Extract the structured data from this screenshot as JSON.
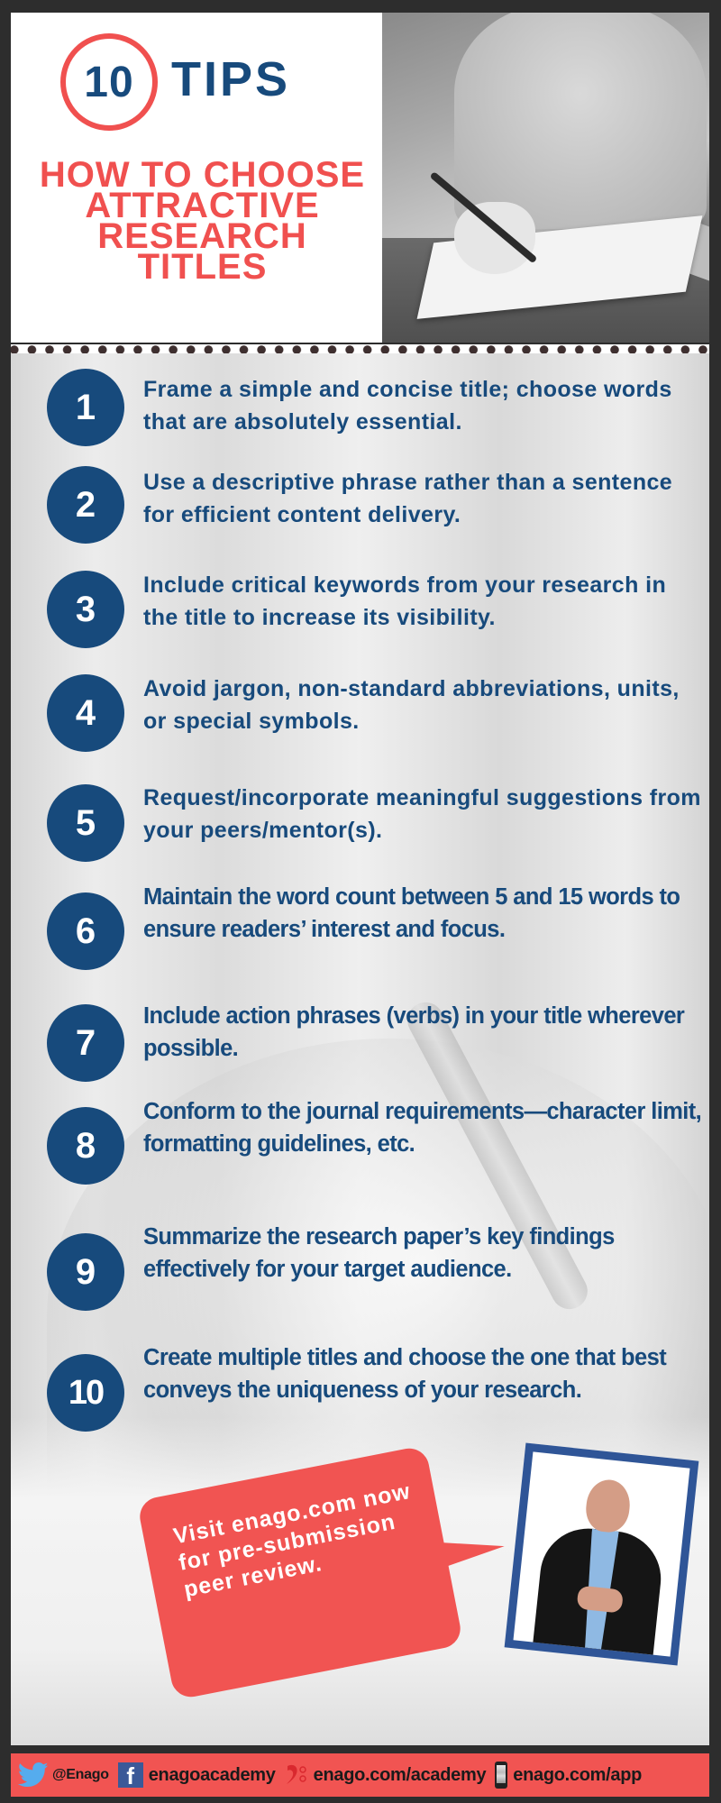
{
  "header": {
    "number": "10",
    "tips_word": "TIPS",
    "subtitle_lines": [
      "HOW TO CHOOSE",
      "ATTRACTIVE",
      "RESEARCH TITLES"
    ]
  },
  "tips": [
    {
      "number": "1",
      "text": "Frame a simple and concise title; choose words that are absolutely essential."
    },
    {
      "number": "2",
      "text": "Use a descriptive phrase rather than a sentence for efficient content delivery."
    },
    {
      "number": "3",
      "text": "Include critical keywords from your research in the title to increase its visibility."
    },
    {
      "number": "4",
      "text": "Avoid jargon, non-standard abbreviations, units, or special symbols."
    },
    {
      "number": "5",
      "text": "Request/incorporate meaningful suggestions from your peers/mentor(s)."
    },
    {
      "number": "6",
      "text": "Maintain the word count between 5 and 15 words to ensure readers’ interest and focus."
    },
    {
      "number": "7",
      "text": "Include action phrases (verbs) in your title wherever possible."
    },
    {
      "number": "8",
      "text": "Conform to the journal requirements—character limit, formatting guidelines, etc."
    },
    {
      "number": "9",
      "text": "Summarize the research paper’s key findings effectively for your target audience."
    },
    {
      "number": "10",
      "text": "Create multiple titles and choose the one that best conveys the uniqueness of your research."
    }
  ],
  "callout": {
    "text": "Visit enago.com now for pre-submission peer review."
  },
  "footer": {
    "twitter": {
      "icon": "twitter-icon",
      "label": "@Enago"
    },
    "facebook": {
      "icon": "facebook-icon",
      "glyph": "f",
      "label": "enagoacademy"
    },
    "academy": {
      "icon": "enago-academy-icon",
      "label": "enago.com/academy"
    },
    "app": {
      "icon": "phone-icon",
      "label": "enago.com/app"
    }
  },
  "colors": {
    "navy": "#174a7c",
    "coral": "#f15452",
    "dots": "#3e2f2f",
    "frame_blue": "#2f5597",
    "twitter_blue": "#55acee",
    "facebook_blue": "#3b5998"
  }
}
